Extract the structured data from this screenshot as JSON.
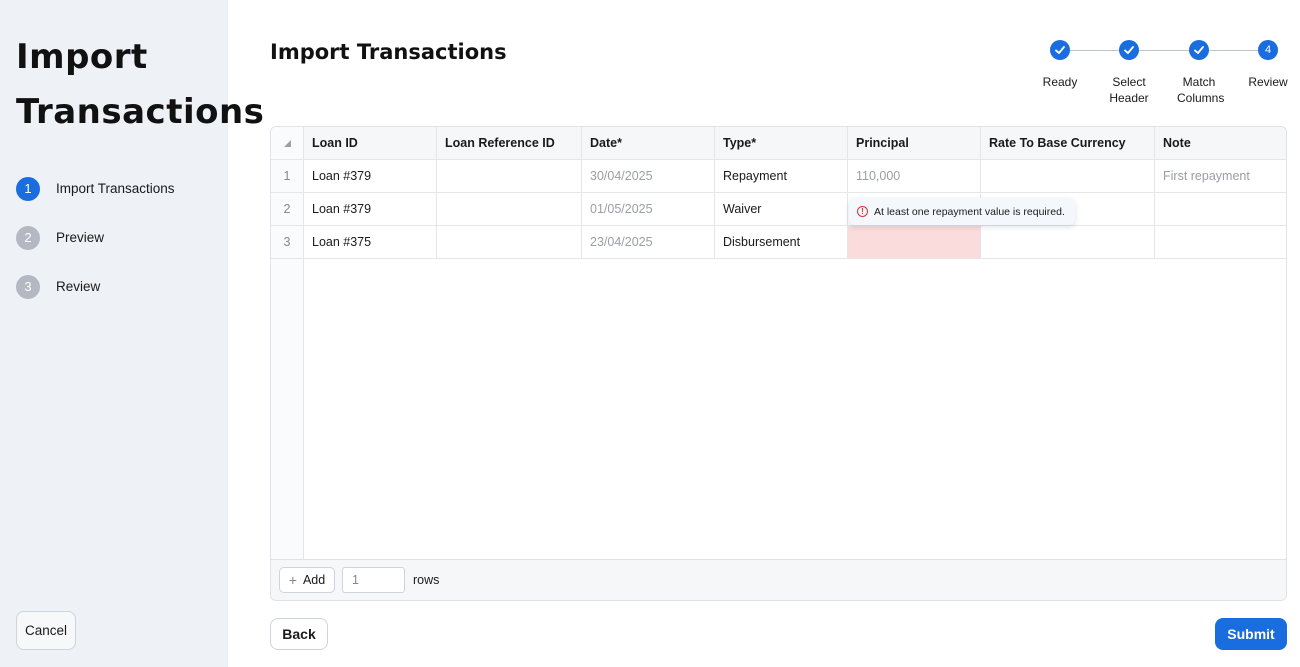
{
  "sidebar": {
    "title_line1": "Import",
    "title_line2": "Transactions",
    "steps": [
      {
        "num": "1",
        "label": "Import Transactions"
      },
      {
        "num": "2",
        "label": "Preview"
      },
      {
        "num": "3",
        "label": "Review"
      }
    ],
    "cancel_label": "Cancel"
  },
  "header": {
    "title": "Import Transactions"
  },
  "stepper": {
    "steps": [
      {
        "label": "Ready",
        "state": "done"
      },
      {
        "label": "Select Header",
        "state": "done"
      },
      {
        "label": "Match Columns",
        "state": "done"
      },
      {
        "label": "Review",
        "state": "current",
        "num": "4"
      }
    ]
  },
  "table": {
    "corner_icon": "triangle-sort-icon",
    "columns": [
      "Loan ID",
      "Loan Reference ID",
      "Date*",
      "Type*",
      "Principal",
      "Rate To Base Currency",
      "Note"
    ],
    "rows": [
      {
        "num": "1",
        "cells": [
          "Loan #379",
          "",
          "30/04/2025",
          "Repayment",
          "110,000",
          "",
          "First repayment"
        ]
      },
      {
        "num": "2",
        "cells": [
          "Loan #379",
          "",
          "01/05/2025",
          "Waiver",
          "",
          "",
          ""
        ]
      },
      {
        "num": "3",
        "cells": [
          "Loan #375",
          "",
          "23/04/2025",
          "Disbursement",
          "",
          "",
          ""
        ]
      }
    ],
    "error_tooltip": "At least one repayment value is required.",
    "footer": {
      "add_label": "Add",
      "rows_value": "1",
      "rows_label": "rows"
    }
  },
  "actions": {
    "back_label": "Back",
    "submit_label": "Submit"
  },
  "colors": {
    "accent": "#1a6dde",
    "sidebar_bg": "#eef1f6",
    "error_bg": "#fbdcdc"
  }
}
